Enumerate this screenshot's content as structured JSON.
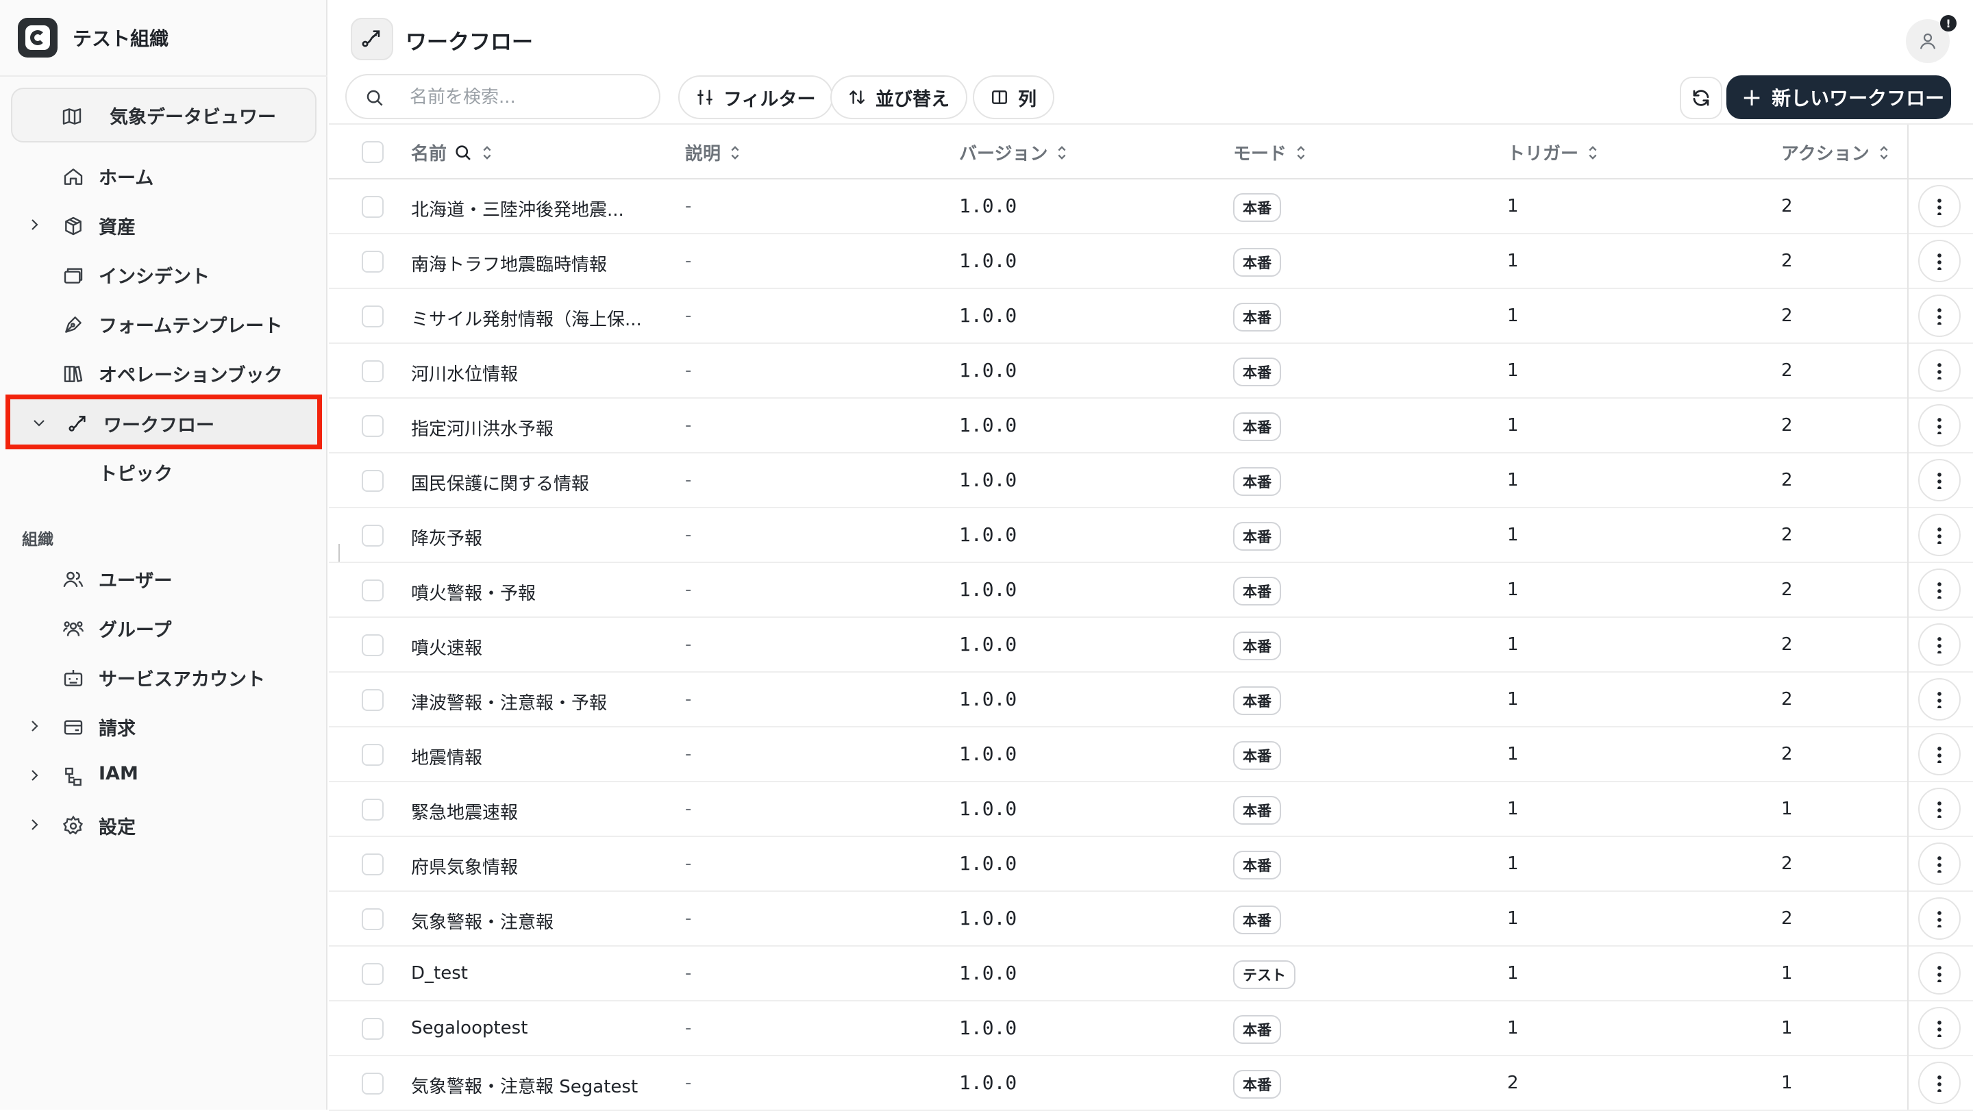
{
  "org": {
    "name": "テスト組織"
  },
  "sidebar": {
    "project": "気象データビュワー",
    "items": [
      {
        "label": "ホーム",
        "icon": "home-icon"
      },
      {
        "label": "資産",
        "icon": "box-icon",
        "expandable": true
      },
      {
        "label": "インシデント",
        "icon": "incident-icon"
      },
      {
        "label": "フォームテンプレート",
        "icon": "form-icon"
      },
      {
        "label": "オペレーションブック",
        "icon": "book-icon"
      },
      {
        "label": "ワークフロー",
        "icon": "workflow-icon",
        "expandable": true,
        "active": true
      },
      {
        "label": "トピック",
        "sub": true
      }
    ],
    "section_label": "組織",
    "org_items": [
      {
        "label": "ユーザー",
        "icon": "users-icon"
      },
      {
        "label": "グループ",
        "icon": "group-icon"
      },
      {
        "label": "サービスアカウント",
        "icon": "bot-icon"
      },
      {
        "label": "請求",
        "icon": "billing-icon",
        "expandable": true
      },
      {
        "label": "IAM",
        "icon": "iam-icon",
        "expandable": true
      },
      {
        "label": "設定",
        "icon": "gear-icon",
        "expandable": true
      }
    ]
  },
  "header": {
    "title": "ワークフロー",
    "notification_badge": "!"
  },
  "toolbar": {
    "search_placeholder": "名前を検索...",
    "filter_label": "フィルター",
    "sort_label": "並び替え",
    "columns_label": "列",
    "new_label": "新しいワークフロー"
  },
  "table": {
    "columns": [
      "名前",
      "説明",
      "バージョン",
      "モード",
      "トリガー",
      "アクション"
    ],
    "rows": [
      {
        "name": "北海道・三陸沖後発地震...",
        "desc": "-",
        "version": "1.0.0",
        "mode": "本番",
        "trigger": "1",
        "action": "2"
      },
      {
        "name": "南海トラフ地震臨時情報",
        "desc": "-",
        "version": "1.0.0",
        "mode": "本番",
        "trigger": "1",
        "action": "2"
      },
      {
        "name": "ミサイル発射情報（海上保...",
        "desc": "-",
        "version": "1.0.0",
        "mode": "本番",
        "trigger": "1",
        "action": "2"
      },
      {
        "name": "河川水位情報",
        "desc": "-",
        "version": "1.0.0",
        "mode": "本番",
        "trigger": "1",
        "action": "2"
      },
      {
        "name": "指定河川洪水予報",
        "desc": "-",
        "version": "1.0.0",
        "mode": "本番",
        "trigger": "1",
        "action": "2"
      },
      {
        "name": "国民保護に関する情報",
        "desc": "-",
        "version": "1.0.0",
        "mode": "本番",
        "trigger": "1",
        "action": "2"
      },
      {
        "name": "降灰予報",
        "desc": "-",
        "version": "1.0.0",
        "mode": "本番",
        "trigger": "1",
        "action": "2"
      },
      {
        "name": "噴火警報・予報",
        "desc": "-",
        "version": "1.0.0",
        "mode": "本番",
        "trigger": "1",
        "action": "2"
      },
      {
        "name": "噴火速報",
        "desc": "-",
        "version": "1.0.0",
        "mode": "本番",
        "trigger": "1",
        "action": "2"
      },
      {
        "name": "津波警報・注意報・予報",
        "desc": "-",
        "version": "1.0.0",
        "mode": "本番",
        "trigger": "1",
        "action": "2"
      },
      {
        "name": "地震情報",
        "desc": "-",
        "version": "1.0.0",
        "mode": "本番",
        "trigger": "1",
        "action": "2"
      },
      {
        "name": "緊急地震速報",
        "desc": "-",
        "version": "1.0.0",
        "mode": "本番",
        "trigger": "1",
        "action": "1"
      },
      {
        "name": "府県気象情報",
        "desc": "-",
        "version": "1.0.0",
        "mode": "本番",
        "trigger": "1",
        "action": "2"
      },
      {
        "name": "気象警報・注意報",
        "desc": "-",
        "version": "1.0.0",
        "mode": "本番",
        "trigger": "1",
        "action": "2"
      },
      {
        "name": "D_test",
        "desc": "-",
        "version": "1.0.0",
        "mode": "テスト",
        "trigger": "1",
        "action": "1"
      },
      {
        "name": "Segalooptest",
        "desc": "-",
        "version": "1.0.0",
        "mode": "本番",
        "trigger": "1",
        "action": "1"
      },
      {
        "name": "気象警報・注意報 Segatest",
        "desc": "-",
        "version": "1.0.0",
        "mode": "本番",
        "trigger": "2",
        "action": "1"
      }
    ]
  },
  "colors": {
    "primary_button": "#1c2938",
    "highlight": "#f2230c"
  }
}
